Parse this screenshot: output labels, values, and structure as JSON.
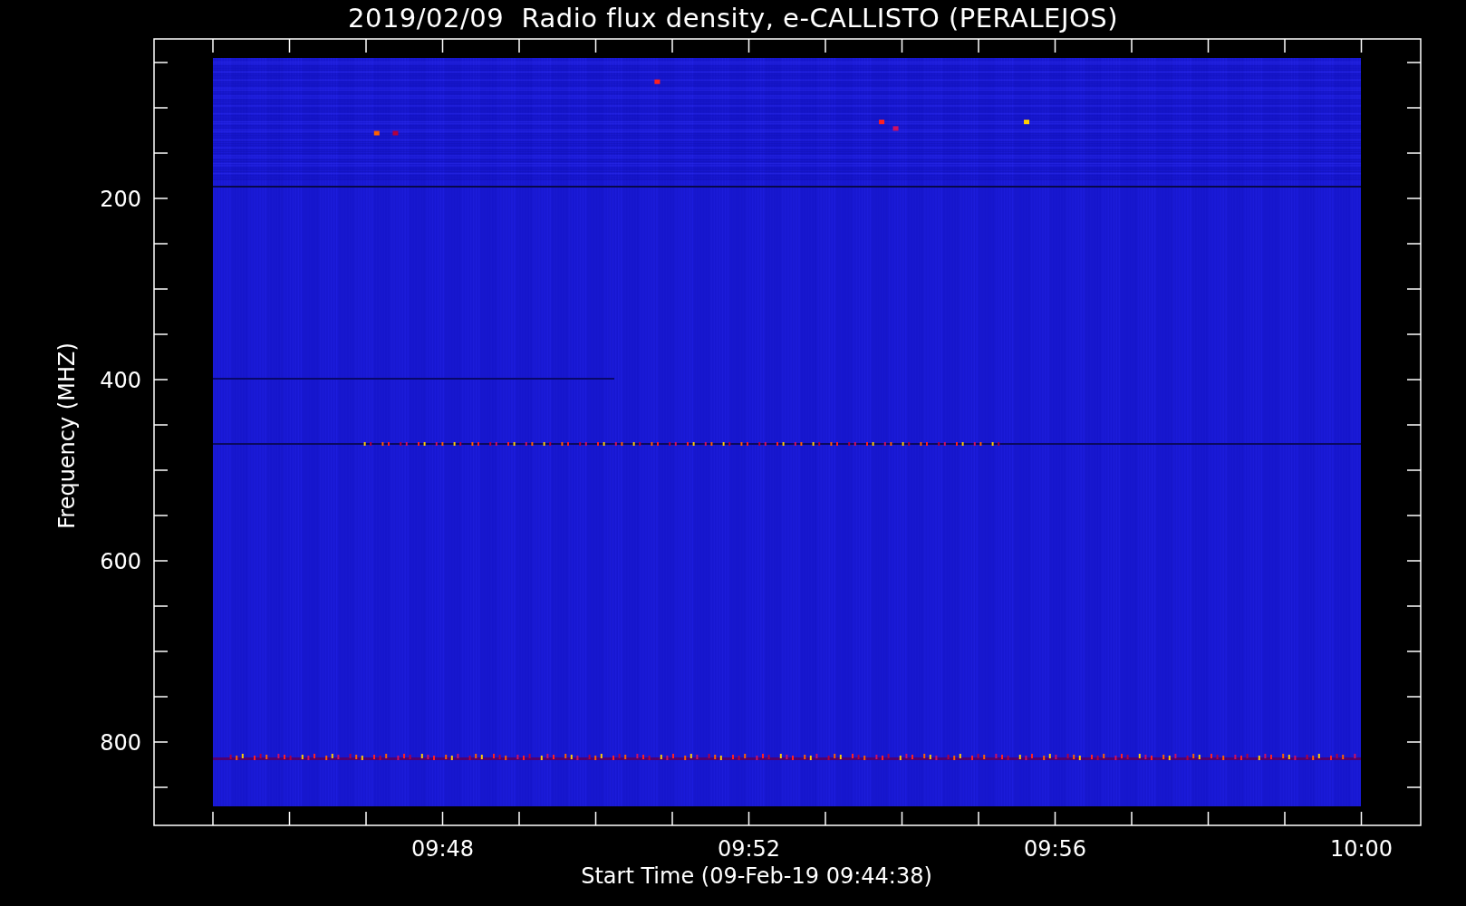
{
  "title": "2019/02/09  Radio flux density, e-CALLISTO (PERALEJOS)",
  "y_axis": {
    "label": "Frequency (MHZ)",
    "ticks": [
      "200",
      "400",
      "600",
      "800"
    ]
  },
  "x_axis": {
    "label": "Start Time (09-Feb-19 09:44:38)",
    "ticks": [
      "09:48",
      "09:52",
      "09:56",
      "10:00"
    ]
  }
}
